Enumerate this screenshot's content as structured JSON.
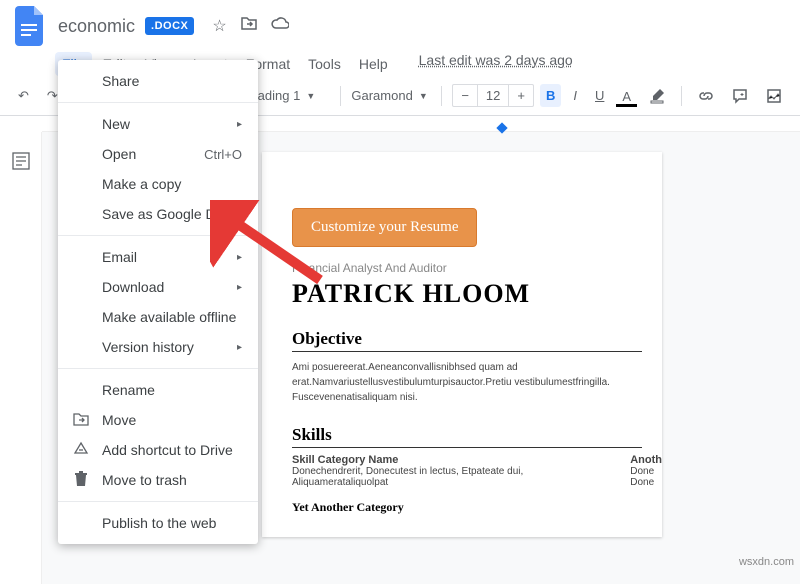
{
  "header": {
    "title": "economic",
    "badge": ".DOCX"
  },
  "menubar": {
    "file": "File",
    "edit": "Edit",
    "view": "View",
    "insert": "Insert",
    "format": "Format",
    "tools": "Tools",
    "help": "Help",
    "last_edit": "Last edit was 2 days ago"
  },
  "toolbar": {
    "heading": "eading 1",
    "font": "Garamond",
    "fontsize": "12",
    "minus": "−",
    "plus": "+",
    "bold": "B",
    "italic": "I",
    "underline": "U",
    "fontcolor": "A"
  },
  "file_menu": {
    "share": "Share",
    "new": "New",
    "open": "Open",
    "open_sc": "Ctrl+O",
    "copy": "Make a copy",
    "save_gdocs": "Save as Google Docs",
    "email": "Email",
    "download": "Download",
    "offline": "Make available offline",
    "version": "Version history",
    "rename": "Rename",
    "move": "Move",
    "shortcut": "Add shortcut to Drive",
    "trash": "Move to trash",
    "publish": "Publish to the web"
  },
  "doc": {
    "customize_btn": "Customize your Resume",
    "subtitle": "Financial Analyst And Auditor",
    "name": "PATRICK HLOOM",
    "objective_h": "Objective",
    "objective_p": "Ami posuereerat.Aeneanconvallisnibhsed quam ad erat.Namvariustellusvestibulumturpisauctor.Pretiu vestibulumestfringilla. Fuscevenenatisaliquam nisi.",
    "skills_h": "Skills",
    "skill_cat1": "Skill Category Name",
    "skill_txt1": "Donechendrerit, Donecutest in lectus, Etpateate dui, Aliquamerataliquolpat",
    "skill_cat2": "Anoth",
    "skill_txt2a": "Done",
    "skill_txt2b": "Done",
    "yet_h": "Yet Another Category"
  },
  "watermark": "wsxdn.com"
}
